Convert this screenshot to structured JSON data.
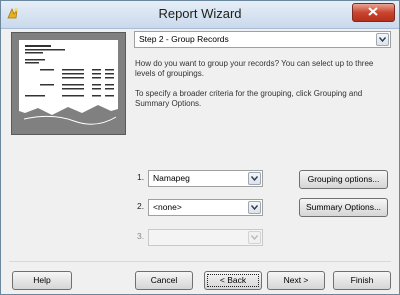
{
  "window": {
    "title": "Report Wizard"
  },
  "step_select": {
    "value": "Step 2 - Group Records"
  },
  "instructions": {
    "line1": "How do you want to group your records? You can select up to three levels of groupings.",
    "line2": "To specify a broader criteria for the grouping, click Grouping and Summary Options."
  },
  "groupings": [
    {
      "number": "1.",
      "value": "Namapeg"
    },
    {
      "number": "2.",
      "value": "<none>"
    },
    {
      "number": "3.",
      "value": ""
    }
  ],
  "buttons": {
    "grouping_options": "Grouping options...",
    "summary_options": "Summary Options...",
    "help": "Help",
    "cancel": "Cancel",
    "back": "< Back",
    "next": "Next >",
    "finish": "Finish"
  }
}
